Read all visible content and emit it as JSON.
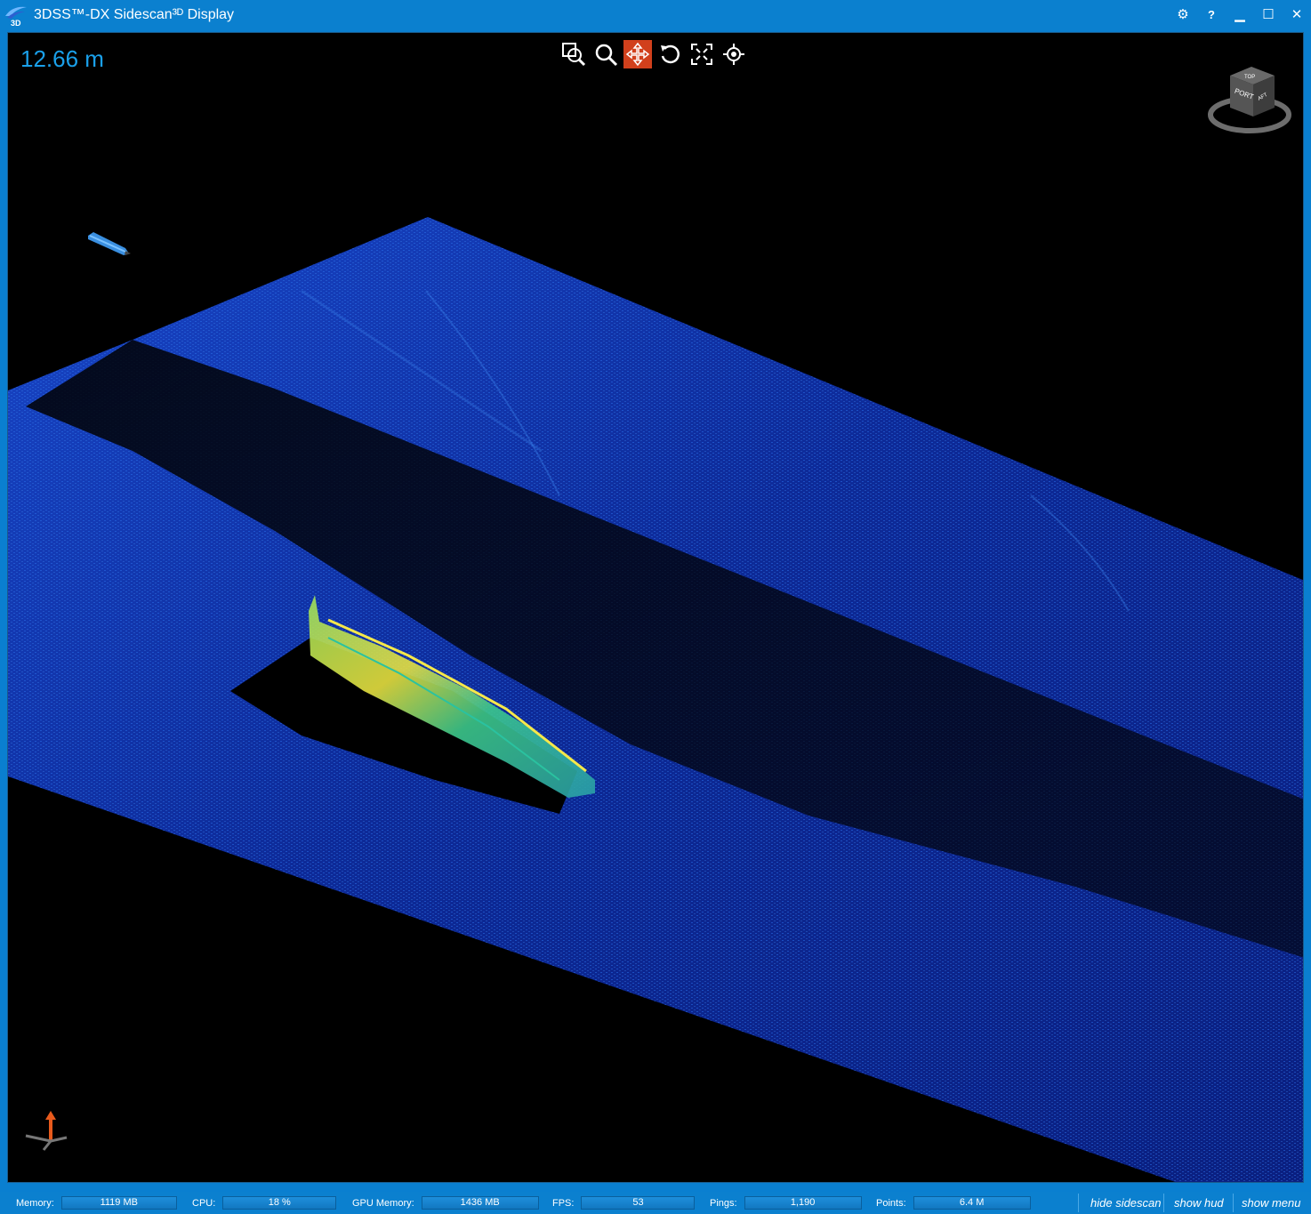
{
  "window": {
    "title": "3DSS™-DX Sidescan³ᴰ Display",
    "logo_text": "3D",
    "controls": [
      {
        "name": "settings-icon",
        "glyph": "⚙"
      },
      {
        "name": "help-icon",
        "glyph": "?"
      },
      {
        "name": "minimize-icon",
        "glyph": "▁"
      },
      {
        "name": "maximize-icon",
        "glyph": "☐"
      },
      {
        "name": "close-icon",
        "glyph": "✕"
      }
    ]
  },
  "viewport": {
    "depth_readout": "12.66 m",
    "tools": [
      {
        "name": "zoom-region-icon",
        "active": false
      },
      {
        "name": "zoom-icon",
        "active": false
      },
      {
        "name": "pan-icon",
        "active": true
      },
      {
        "name": "rotate-icon",
        "active": false
      },
      {
        "name": "fit-extents-icon",
        "active": false
      },
      {
        "name": "center-target-icon",
        "active": false
      }
    ],
    "view_cube": {
      "face_front": "PORT",
      "face_top": "TOP",
      "face_side": "AFT"
    },
    "colors": {
      "seafloor_low": "#0a1f8a",
      "seafloor_high": "#1e5ad8",
      "target_high": "#f0e040",
      "target_mid": "#3cc88c",
      "accent_tool": "#d1401c",
      "depth_text": "#1aa0ea"
    }
  },
  "status": {
    "memory": {
      "label": "Memory:",
      "value": "1119 MB"
    },
    "cpu": {
      "label": "CPU:",
      "value": "18 %"
    },
    "gpu_memory": {
      "label": "GPU Memory:",
      "value": "1436 MB"
    },
    "fps": {
      "label": "FPS:",
      "value": "53"
    },
    "pings": {
      "label": "Pings:",
      "value": "1,190"
    },
    "points": {
      "label": "Points:",
      "value": "6.4 M"
    },
    "links": {
      "hide_sidescan": "hide sidescan",
      "show_hud": "show hud",
      "show_menu": "show menu"
    }
  }
}
